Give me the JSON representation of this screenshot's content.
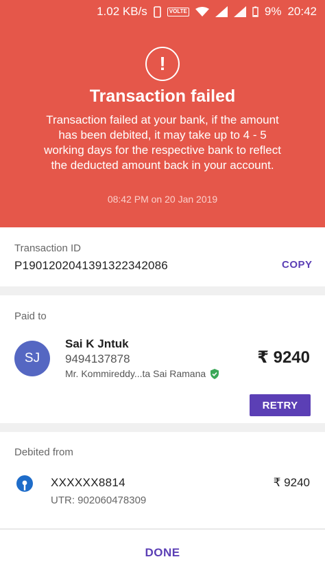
{
  "status_bar": {
    "speed": "1.02 KB/s",
    "volte": "VOLTE",
    "battery": "9%",
    "time": "20:42"
  },
  "header": {
    "title": "Transaction failed",
    "message": "Transaction failed at your bank, if the amount has been debited, it may take up to 4 - 5 working days for the respective bank to reflect the deducted amount back in your account.",
    "timestamp": "08:42 PM on 20 Jan 2019",
    "background_color": "#e5574a",
    "icon": "alert-circle-icon"
  },
  "transaction": {
    "label": "Transaction ID",
    "id": "P1901202041391322342086",
    "copy_label": "COPY"
  },
  "paid_to": {
    "label": "Paid to",
    "avatar_initials": "SJ",
    "name": "Sai K Jntuk",
    "phone": "9494137878",
    "full_name": "Mr. Kommireddy...ta Sai Ramana",
    "amount": "₹ 9240",
    "retry_label": "RETRY"
  },
  "debited_from": {
    "label": "Debited from",
    "account": "XXXXXX8814",
    "utr": "UTR: 902060478309",
    "amount": "₹ 9240",
    "bank_icon": "sbi-bank-icon"
  },
  "footer": {
    "done_label": "DONE"
  },
  "colors": {
    "accent": "#5b3fb5",
    "error": "#e5574a",
    "avatar": "#5567c2",
    "verified": "#3aa757"
  }
}
